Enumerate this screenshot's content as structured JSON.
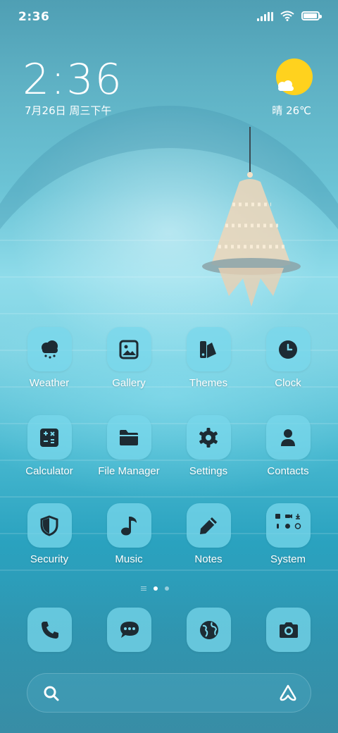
{
  "status_bar": {
    "time": "2:36",
    "icons": [
      "signal-icon",
      "wifi-icon",
      "battery-icon"
    ],
    "battery_level": 0.85
  },
  "clock_widget": {
    "time": "2:36",
    "date": "7月26日 周三下午"
  },
  "weather_widget": {
    "icon": "partly-sunny-icon",
    "text": "晴 26℃",
    "sun_color": "#ffd21e"
  },
  "apps": [
    {
      "label": "Weather",
      "icon": "cloud-rain-icon"
    },
    {
      "label": "Gallery",
      "icon": "image-icon"
    },
    {
      "label": "Themes",
      "icon": "themes-icon"
    },
    {
      "label": "Clock",
      "icon": "clock-icon"
    },
    {
      "label": "Calculator",
      "icon": "calculator-icon"
    },
    {
      "label": "File Manager",
      "icon": "folder-icon"
    },
    {
      "label": "Settings",
      "icon": "gear-icon"
    },
    {
      "label": "Contacts",
      "icon": "person-icon"
    },
    {
      "label": "Security",
      "icon": "shield-icon"
    },
    {
      "label": "Music",
      "icon": "music-note-icon"
    },
    {
      "label": "Notes",
      "icon": "pencil-icon"
    },
    {
      "label": "System",
      "icon": "folder-grid-icon"
    }
  ],
  "page_indicator": {
    "pages": 2,
    "active": 1
  },
  "dock": [
    {
      "icon": "phone-icon"
    },
    {
      "icon": "message-icon"
    },
    {
      "icon": "globe-icon"
    },
    {
      "icon": "camera-icon"
    }
  ],
  "search_bar": {
    "left_icon": "search-icon",
    "right_icon": "assistant-icon"
  },
  "colors": {
    "icon_bg": "#78d7eb",
    "icon_glyph": "#1d2b33",
    "text": "#ffffff"
  }
}
